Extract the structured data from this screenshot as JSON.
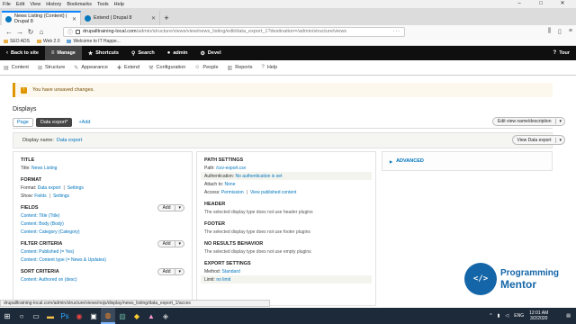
{
  "menubar": [
    "File",
    "Edit",
    "View",
    "History",
    "Bookmarks",
    "Tools",
    "Help"
  ],
  "browser_tabs": [
    {
      "title": "News Listing (Content) | Drupal 8",
      "active": true
    },
    {
      "title": "Extend | Drupal 8",
      "active": false
    }
  ],
  "url": {
    "host": "drupalltraining-local.com",
    "path": "/admin/structure/views/view/news_listing/edit/data_export_1?destination=/admin/structure/views"
  },
  "bookmarks": [
    "SEO ADS",
    "Web 2.0",
    "Welcome to IT Happe..."
  ],
  "toolbar": {
    "back": "Back to site",
    "manage": "Manage",
    "shortcuts": "Shortcuts",
    "search": "Search",
    "user": "admin",
    "devel": "Devel",
    "tour": "Tour"
  },
  "admin_menu": [
    "Content",
    "Structure",
    "Appearance",
    "Extend",
    "Configuration",
    "People",
    "Reports",
    "Help"
  ],
  "warning": "You have unsaved changes.",
  "displays": {
    "heading": "Displays",
    "tabs": [
      "Page",
      "Data export*",
      "Add"
    ],
    "edit_button": "Edit view name/description",
    "display_name_label": "Display name:",
    "display_name_value": "Data export",
    "view_button": "View Data export"
  },
  "col1": {
    "title_heading": "TITLE",
    "title_label": "Title:",
    "title_value": "News Listing",
    "format_heading": "FORMAT",
    "format_label": "Format:",
    "format_value": "Data export",
    "format_settings": "Settings",
    "show_label": "Show:",
    "show_value": "Fields",
    "show_settings": "Settings",
    "fields_heading": "FIELDS",
    "fields": [
      "Content: Title (Title)",
      "Content: Body (Body)",
      "Content: Category (Category)"
    ],
    "filter_heading": "FILTER CRITERIA",
    "filters": [
      "Content: Published (= Yes)",
      "Content: Content type (= News & Updates)"
    ],
    "sort_heading": "SORT CRITERIA",
    "sorts": [
      "Content: Authored on (desc)"
    ],
    "add_label": "Add"
  },
  "col2": {
    "path_heading": "PATH SETTINGS",
    "path_label": "Path:",
    "path_value": "/csv-export.csv",
    "auth_label": "Authentication:",
    "auth_value": "No authentication is set",
    "attach_label": "Attach to:",
    "attach_value": "None",
    "access_label": "Access:",
    "access_value": "Permission",
    "access_value2": "View published content",
    "header_heading": "HEADER",
    "header_text": "The selected display type does not use header plugins",
    "footer_heading": "FOOTER",
    "footer_text": "The selected display type does not use footer plugins",
    "noresults_heading": "NO RESULTS BEHAVIOR",
    "noresults_text": "The selected display type does not use empty plugins",
    "export_heading": "EXPORT SETTINGS",
    "method_label": "Method:",
    "method_value": "Standard",
    "limit_label": "Limit:",
    "limit_value": "no limit"
  },
  "col3": {
    "advanced": "ADVANCED"
  },
  "logo": {
    "line1": "Programming",
    "line2": "Mentor"
  },
  "statusbar": "drupalltraining-local.com/admin/structure/views/nojs/display/news_listing/data_export_1/acces",
  "taskbar": {
    "lang": "ENG",
    "time": "12:01 AM",
    "date": "3/2/2020"
  }
}
